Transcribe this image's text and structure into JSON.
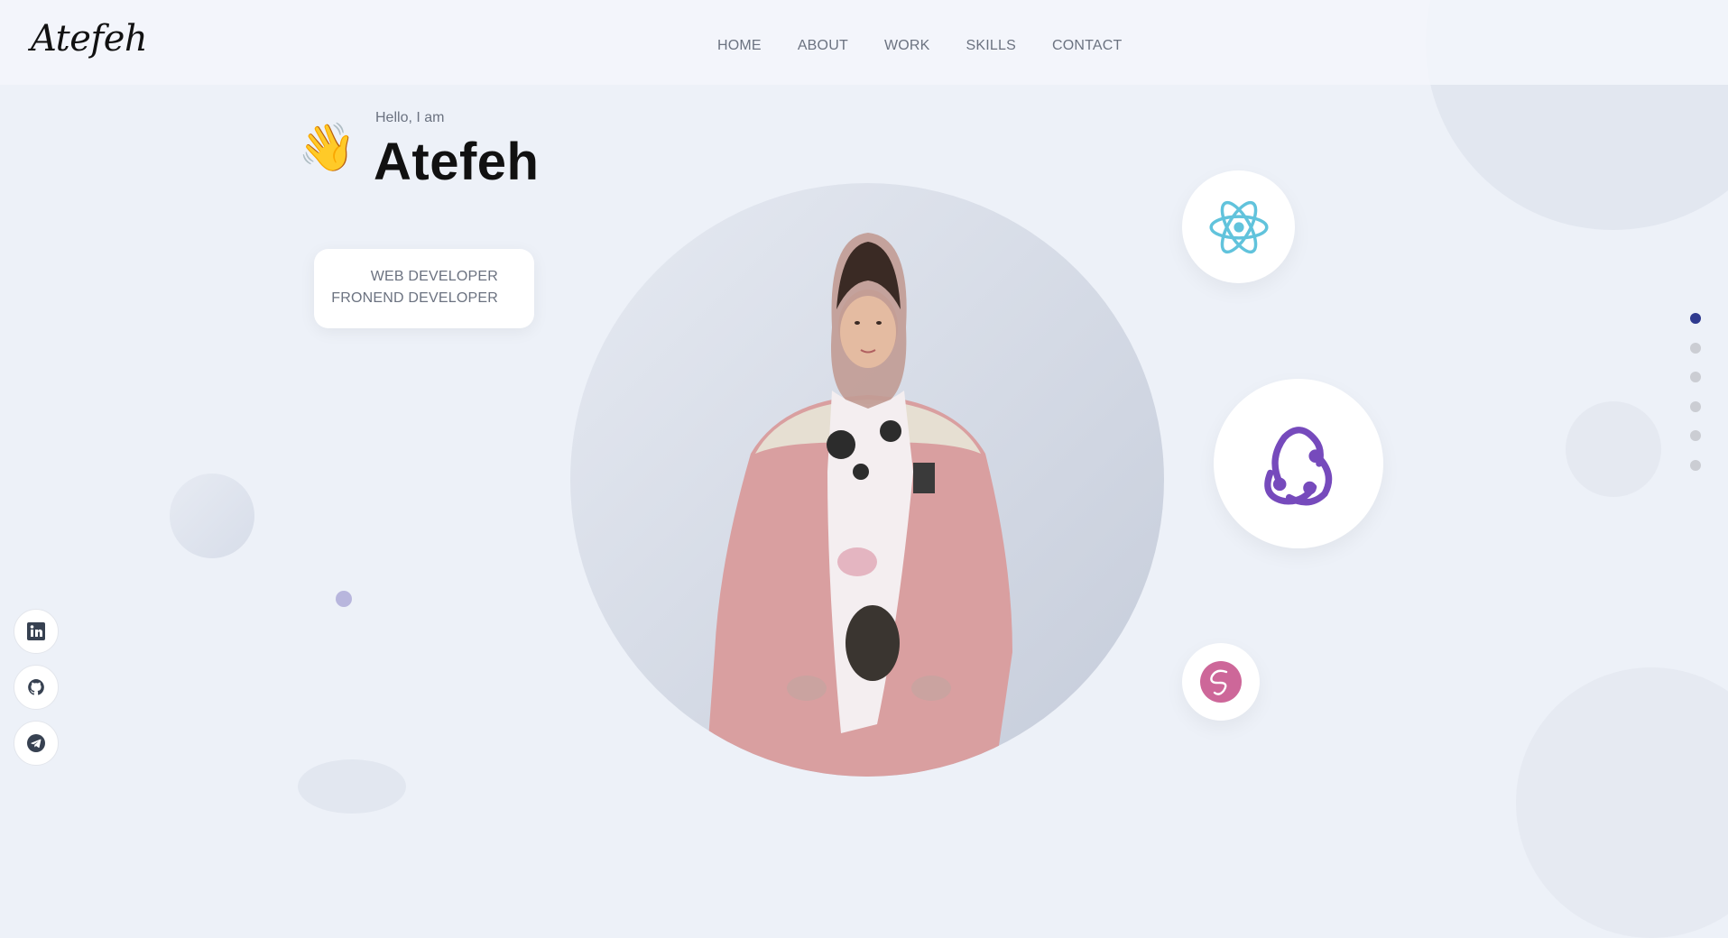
{
  "header": {
    "logo": "Atefeh",
    "nav": [
      "HOME",
      "ABOUT",
      "WORK",
      "SKILLS",
      "CONTACT"
    ]
  },
  "hero": {
    "greeting": "Hello, I am",
    "name": "Atefeh",
    "wave_emoji": "👋",
    "roles": [
      "WEB DEVELOPER",
      "FRONEND DEVELOPER"
    ]
  },
  "tech_icons": [
    "react-icon",
    "redux-icon",
    "sass-icon"
  ],
  "section_pager": {
    "count": 6,
    "active_index": 0
  },
  "social_links": [
    "linkedin-icon",
    "github-icon",
    "telegram-icon"
  ],
  "colors": {
    "background": "#edf1f8",
    "accent": "#2f3a8f",
    "react": "#61c3dc",
    "redux": "#764abc",
    "sass": "#cd6799",
    "coat": "#d99fa0"
  }
}
